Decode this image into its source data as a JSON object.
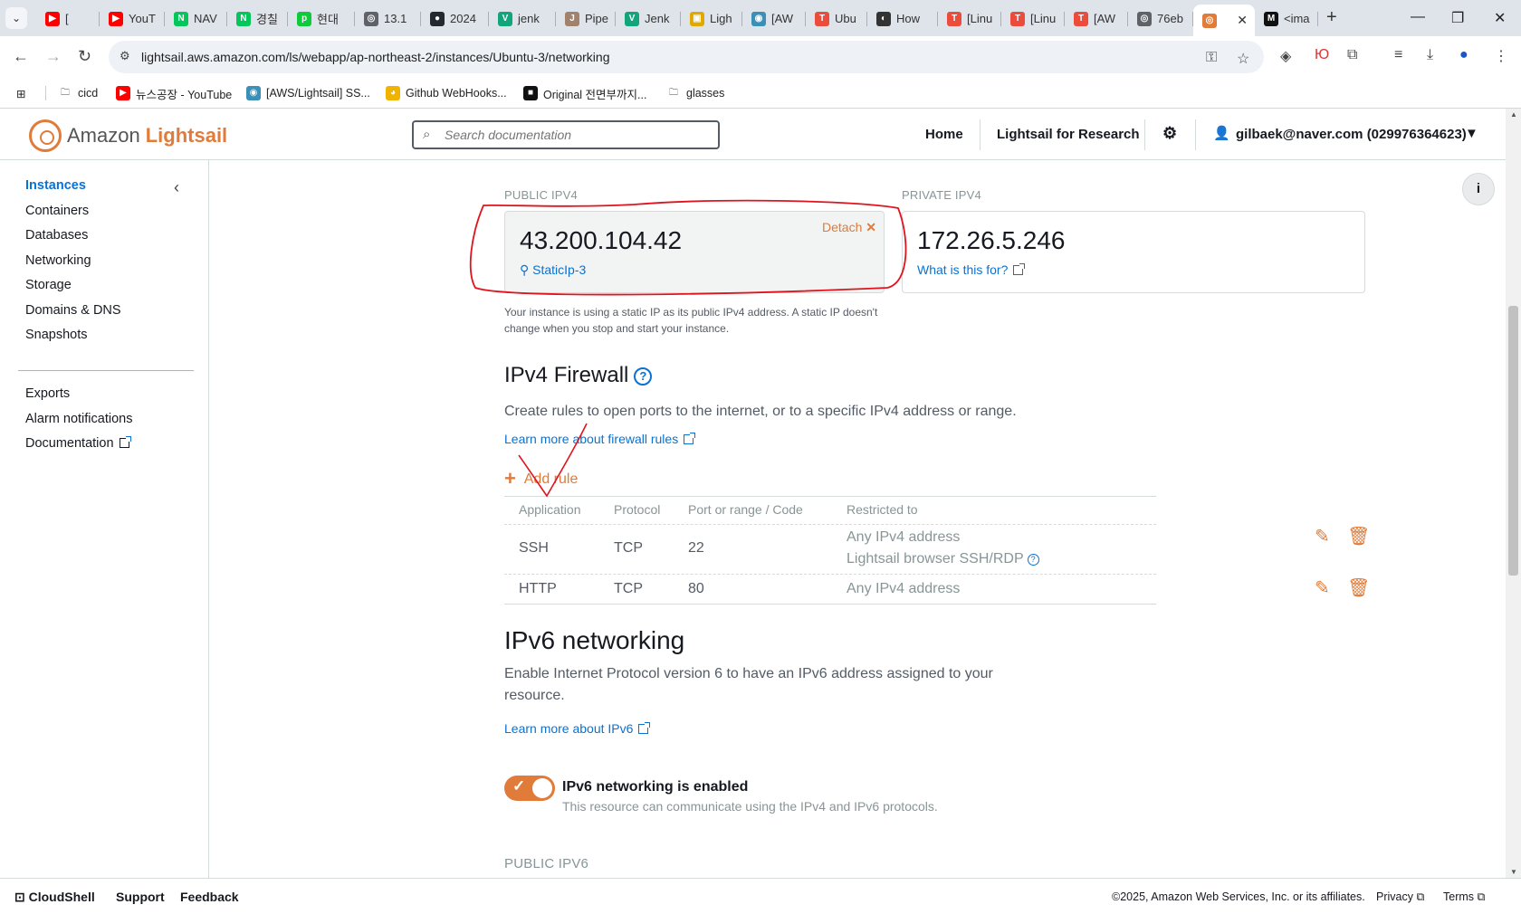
{
  "browser": {
    "tabs": [
      {
        "label": "[",
        "fav": "youtube",
        "color": "#ff0000",
        "favText": "▶"
      },
      {
        "label": "YouT",
        "fav": "youtube",
        "color": "#ff0000",
        "favText": "▶"
      },
      {
        "label": "NAV",
        "fav": "naver",
        "color": "#03c75a",
        "favText": "N"
      },
      {
        "label": "경칠",
        "fav": "naver",
        "color": "#03c75a",
        "favText": "N"
      },
      {
        "label": "현대",
        "fav": "pay",
        "color": "#0ecb3b",
        "favText": "p"
      },
      {
        "label": "13.1",
        "fav": "globe",
        "color": "#5f6368",
        "favText": "◎"
      },
      {
        "label": "2024",
        "fav": "github",
        "color": "#24292f",
        "favText": "●"
      },
      {
        "label": "jenk",
        "fav": "vue",
        "color": "#11a57b",
        "favText": "V"
      },
      {
        "label": "Pipe",
        "fav": "jenkins",
        "color": "#a0826d",
        "favText": "J"
      },
      {
        "label": "Jenk",
        "fav": "vue",
        "color": "#11a57b",
        "favText": "V"
      },
      {
        "label": "Ligh",
        "fav": "aws-box",
        "color": "#e0a800",
        "favText": "▣"
      },
      {
        "label": "[AW",
        "fav": "aws-ls",
        "color": "#3c8fb5",
        "favText": "◉"
      },
      {
        "label": "Ubu",
        "fav": "tistory",
        "color": "#eb4c3b",
        "favText": "T"
      },
      {
        "label": "How",
        "fav": "medium",
        "color": "#333333",
        "favText": "◐"
      },
      {
        "label": "[Linu",
        "fav": "tistory",
        "color": "#eb4c3b",
        "favText": "T"
      },
      {
        "label": "[Linu",
        "fav": "tistory",
        "color": "#eb4c3b",
        "favText": "T"
      },
      {
        "label": "[AW",
        "fav": "tistory",
        "color": "#eb4c3b",
        "favText": "T"
      },
      {
        "label": "76eb",
        "fav": "globe",
        "color": "#5f6368",
        "favText": "◎"
      },
      {
        "label": "",
        "fav": "lightsail",
        "color": "#e07b39",
        "favText": "◎",
        "active": true
      },
      {
        "label": "<ima",
        "fav": "medium-m",
        "color": "#111111",
        "favText": "M"
      }
    ],
    "url": "lightsail.aws.amazon.com/ls/webapp/ap-northeast-2/instances/Ubuntu-3/networking",
    "bookmarks": [
      {
        "label": "cicd",
        "icon": "folder-icon"
      },
      {
        "label": "뉴스공장 - YouTube",
        "icon": "youtube-icon"
      },
      {
        "label": "[AWS/Lightsail] SS...",
        "icon": "lightsail-icon"
      },
      {
        "label": "Github WebHooks...",
        "icon": "github-icon"
      },
      {
        "label": "Original 전면부까지...",
        "icon": "bookmark-icon"
      },
      {
        "label": "glasses",
        "icon": "folder-icon"
      }
    ]
  },
  "header": {
    "brand_prefix": "Amazon",
    "brand_name": "Lightsail",
    "search_placeholder": "Search documentation",
    "nav_home": "Home",
    "nav_research": "Lightsail for Research",
    "account": "gilbaek@naver.com (029976364623)"
  },
  "sidebar": {
    "primary": [
      "Instances",
      "Containers",
      "Databases",
      "Networking",
      "Storage",
      "Domains & DNS",
      "Snapshots"
    ],
    "secondary": [
      "Exports",
      "Alarm notifications",
      "Documentation"
    ]
  },
  "ipv4": {
    "public_label": "PUBLIC IPV4",
    "public_ip": "43.200.104.42",
    "detach": "Detach",
    "static_ip_name": "StaticIp-3",
    "private_label": "PRIVATE IPV4",
    "private_ip": "172.26.5.246",
    "what_is": "What is this for?",
    "static_note_1": "Your instance is using a static IP as its public IPv4 address. A static IP doesn't",
    "static_note_2": "change when you stop and start your instance."
  },
  "firewall": {
    "title": "IPv4 Firewall",
    "desc": "Create rules to open ports to the internet, or to a specific IPv4 address or range.",
    "learn_more": "Learn more about firewall rules",
    "add_rule": "Add rule",
    "columns": [
      "Application",
      "Protocol",
      "Port or range / Code",
      "Restricted to"
    ],
    "rules": [
      {
        "app": "SSH",
        "protocol": "TCP",
        "port": "22",
        "restricted": "Any IPv4 address",
        "restricted2": "Lightsail browser SSH/RDP"
      },
      {
        "app": "HTTP",
        "protocol": "TCP",
        "port": "80",
        "restricted": "Any IPv4 address",
        "restricted2": ""
      }
    ]
  },
  "ipv6": {
    "title": "IPv6 networking",
    "desc_1": "Enable Internet Protocol version 6 to have an IPv6 address assigned to your",
    "desc_2": "resource.",
    "learn_more": "Learn more about IPv6",
    "toggle_title": "IPv6 networking is enabled",
    "toggle_desc": "This resource can communicate using the IPv4 and IPv6 protocols.",
    "toggle_on": true,
    "public_label": "PUBLIC IPV6"
  },
  "footer": {
    "cloudshell": "CloudShell",
    "support": "Support",
    "feedback": "Feedback",
    "copyright": "©2025, Amazon Web Services, Inc. or its affiliates.",
    "privacy": "Privacy",
    "terms": "Terms"
  },
  "colors": {
    "accent": "#e07b39",
    "link": "#0972d3",
    "annotation": "#e0141e"
  }
}
